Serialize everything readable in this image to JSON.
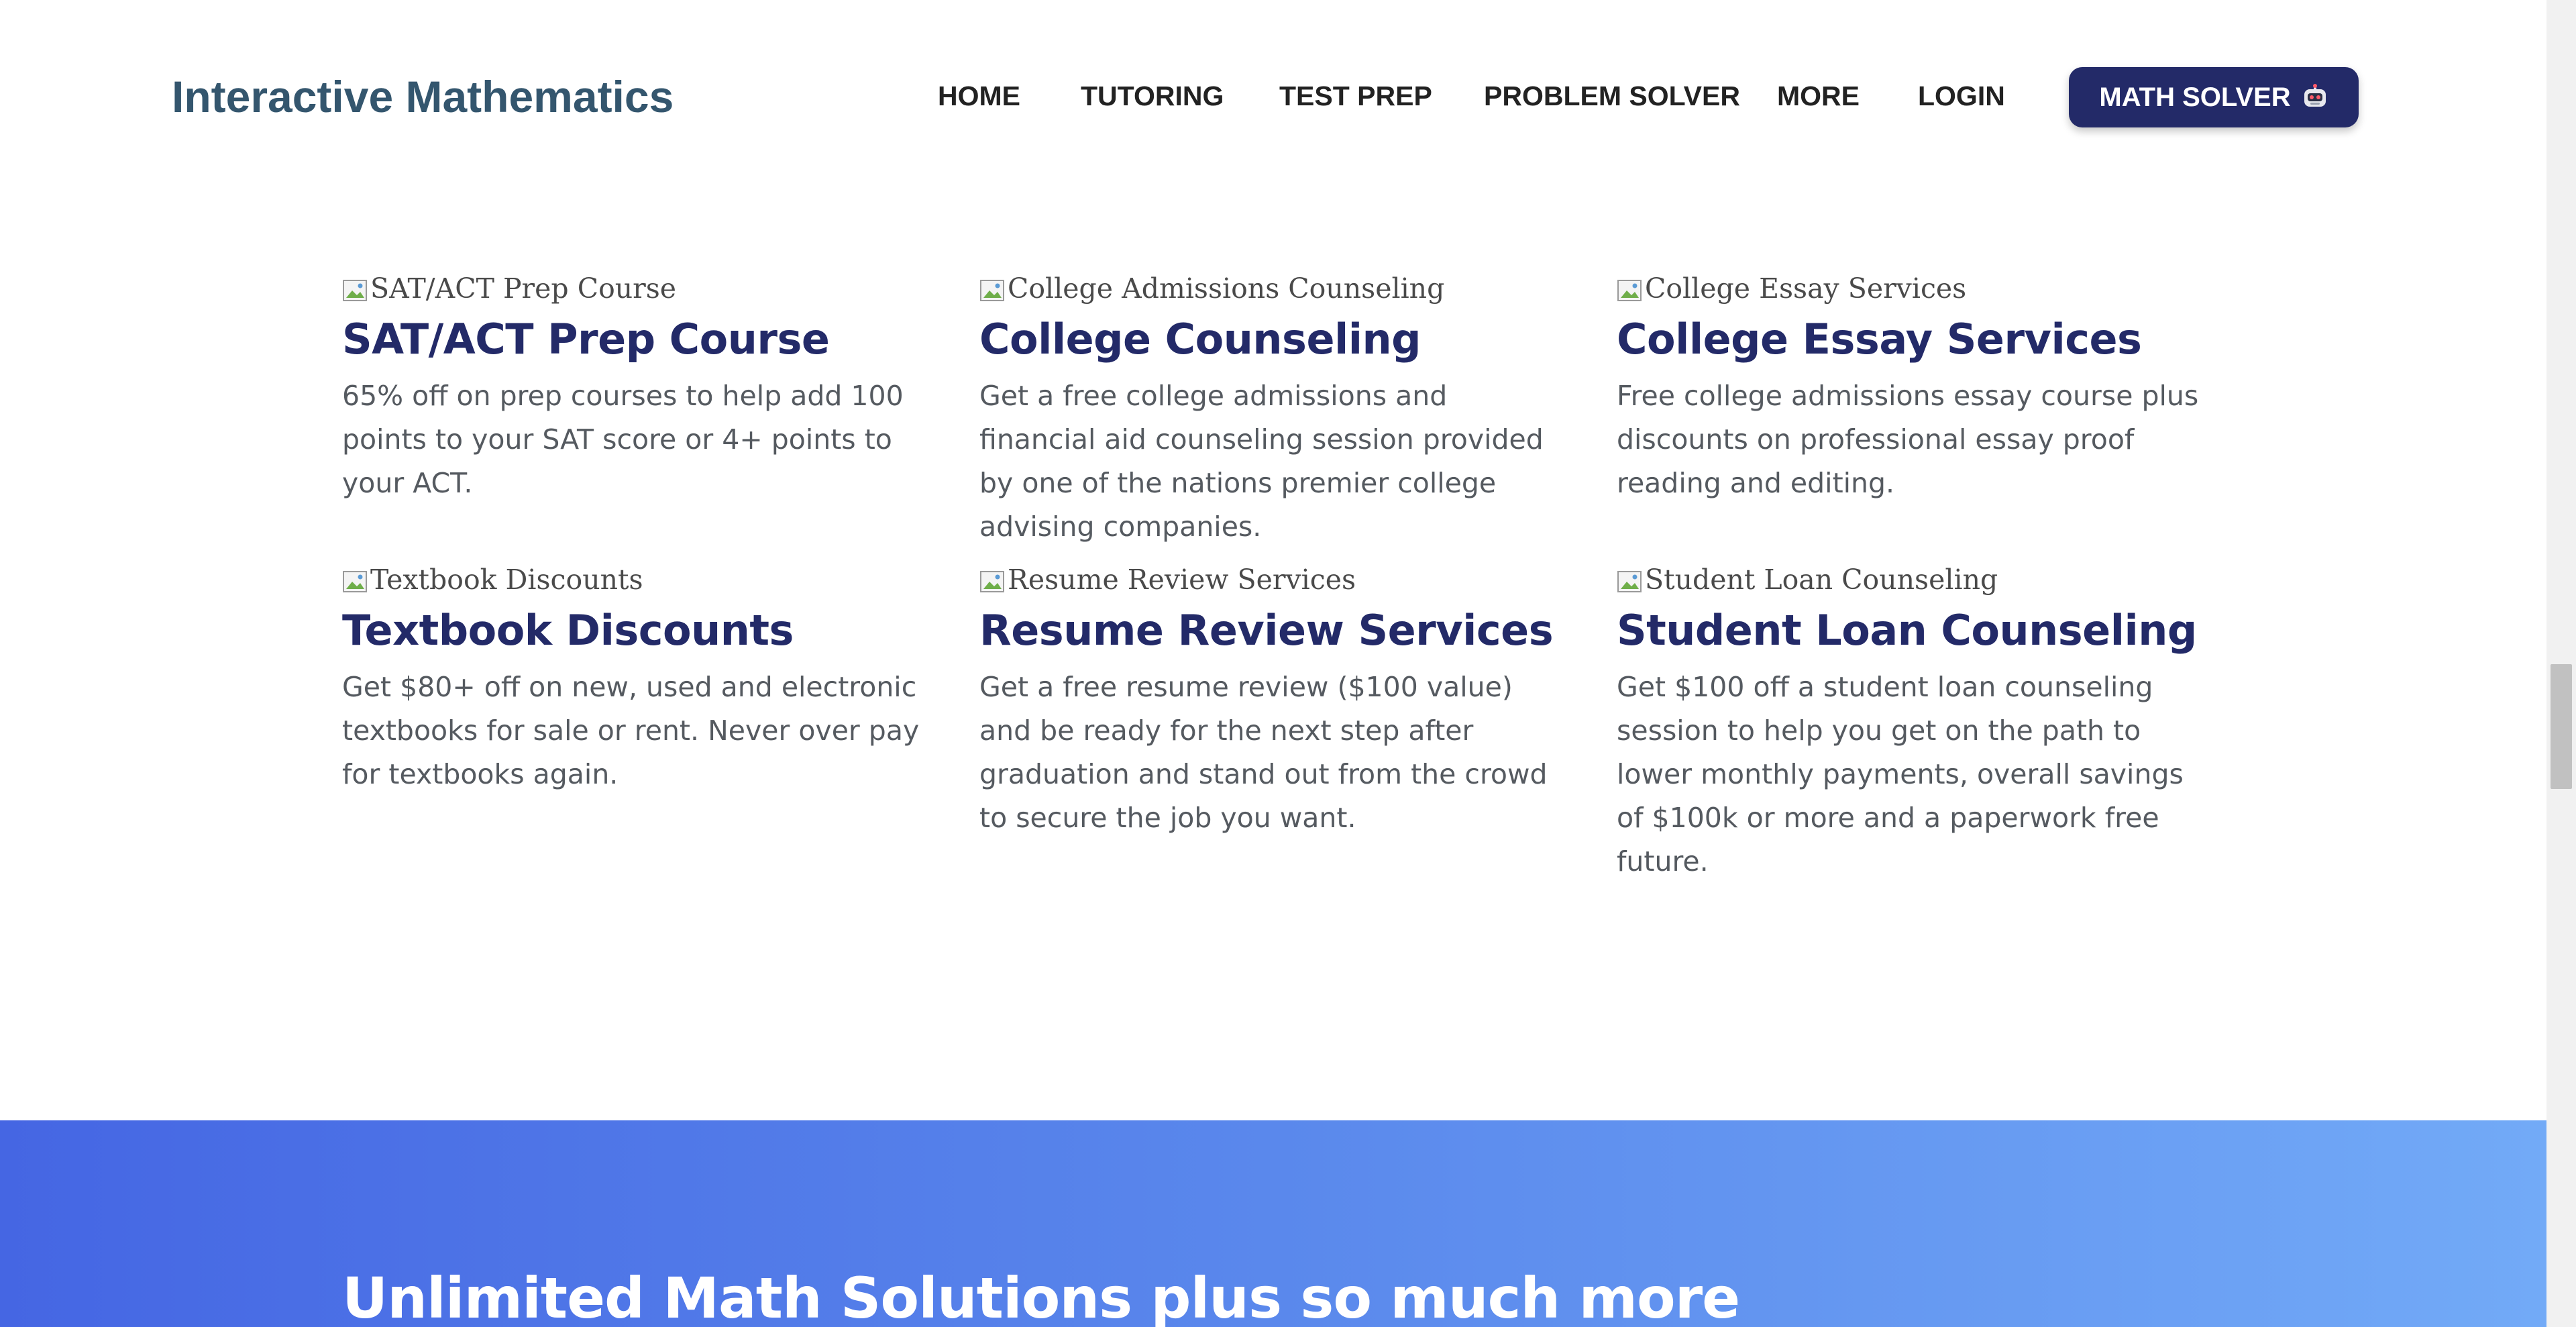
{
  "header": {
    "logo": "Interactive Mathematics",
    "nav": [
      {
        "label": "HOME"
      },
      {
        "label": "TUTORING"
      },
      {
        "label": "TEST PREP"
      },
      {
        "label": "PROBLEM SOLVER"
      },
      {
        "label": "MORE"
      },
      {
        "label": "LOGIN"
      }
    ],
    "cta_label": "MATH SOLVER",
    "cta_icon": "robot-icon"
  },
  "cards": [
    {
      "img_alt": "SAT/ACT Prep Course",
      "title": "SAT/ACT Prep Course",
      "description": "65% off on prep courses to help add 100 points to your SAT score or 4+ points to your ACT."
    },
    {
      "img_alt": "College Admissions Counseling",
      "title": "College Counseling",
      "description": "Get a free college admissions and financial aid counseling session provided by one of the nations premier college advising companies."
    },
    {
      "img_alt": "College Essay Services",
      "title": "College Essay Services",
      "description": "Free college admissions essay course plus discounts on professional essay proof reading and editing."
    },
    {
      "img_alt": "Textbook Discounts",
      "title": "Textbook Discounts",
      "description": "Get $80+ off on new, used and electronic textbooks for sale or rent. Never over pay for textbooks again."
    },
    {
      "img_alt": "Resume Review Services",
      "title": "Resume Review Services",
      "description": "Get a free resume review ($100 value) and be ready for the next step after graduation and stand out from the crowd to secure the job you want."
    },
    {
      "img_alt": "Student Loan Counseling",
      "title": "Student Loan Counseling",
      "description": "Get $100 off a student loan counseling session to help you get on the path to lower monthly payments, overall savings of $100k or more and a paperwork free future."
    }
  ],
  "banner": {
    "title": "Unlimited Math Solutions plus so much more"
  },
  "colors": {
    "brand_navy": "#232a68",
    "logo": "#34566e",
    "banner_start": "#4566e3",
    "banner_end": "#72aaf7"
  }
}
